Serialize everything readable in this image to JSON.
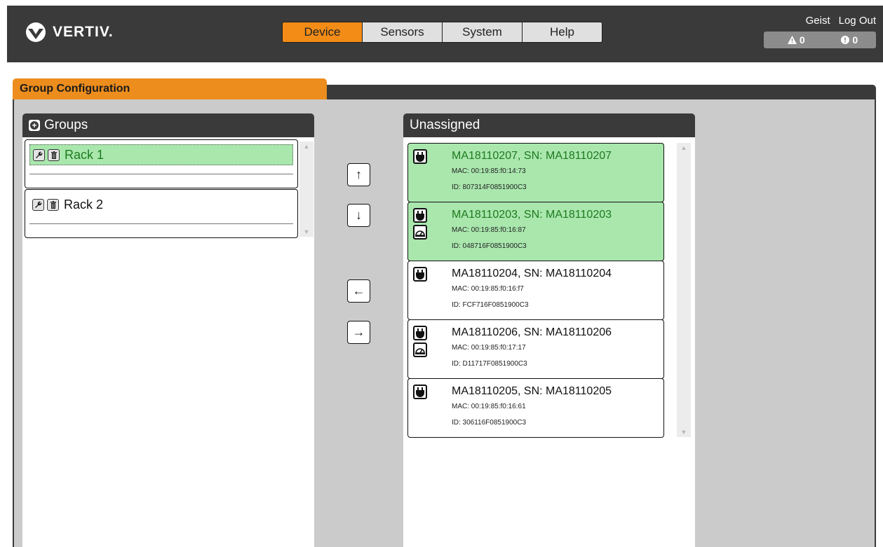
{
  "header": {
    "brand": "VERTIV.",
    "nav": [
      {
        "label": "Device",
        "active": true
      },
      {
        "label": "Sensors",
        "active": false
      },
      {
        "label": "System",
        "active": false
      },
      {
        "label": "Help",
        "active": false
      }
    ],
    "user": "Geist",
    "logout": "Log Out",
    "alarm_count": "0",
    "warning_count": "0",
    "accent_color": "#f28c16"
  },
  "panel": {
    "title": "Group Configuration"
  },
  "groups": {
    "title": "Groups",
    "items": [
      {
        "name": "Rack 1",
        "selected": true
      },
      {
        "name": "Rack 2",
        "selected": false
      }
    ]
  },
  "move_buttons": {
    "up": "↑",
    "down": "↓",
    "left": "←",
    "right": "→"
  },
  "unassigned": {
    "title": "Unassigned",
    "devices": [
      {
        "title": "MA18110207, SN: MA18110207",
        "mac": "MAC: 00:19:85:f0:14:73",
        "id": "ID: 807314F0851900C3",
        "selected": true,
        "icons": [
          "plug-icon"
        ]
      },
      {
        "title": "MA18110203, SN: MA18110203",
        "mac": "MAC: 00:19:85:f0:16:87",
        "id": "ID: 048716F0851900C3",
        "selected": true,
        "icons": [
          "plug-icon",
          "meter-icon"
        ]
      },
      {
        "title": "MA18110204, SN: MA18110204",
        "mac": "MAC: 00:19:85:f0:16:f7",
        "id": "ID: FCF716F0851900C3",
        "selected": false,
        "icons": [
          "plug-icon"
        ]
      },
      {
        "title": "MA18110206, SN: MA18110206",
        "mac": "MAC: 00:19:85:f0:17:17",
        "id": "ID: D11717F0851900C3",
        "selected": false,
        "icons": [
          "plug-icon",
          "meter-icon"
        ]
      },
      {
        "title": "MA18110205, SN: MA18110205",
        "mac": "MAC: 00:19:85:f0:16:61",
        "id": "ID: 306116F0851900C3",
        "selected": false,
        "icons": [
          "plug-icon"
        ]
      }
    ]
  }
}
